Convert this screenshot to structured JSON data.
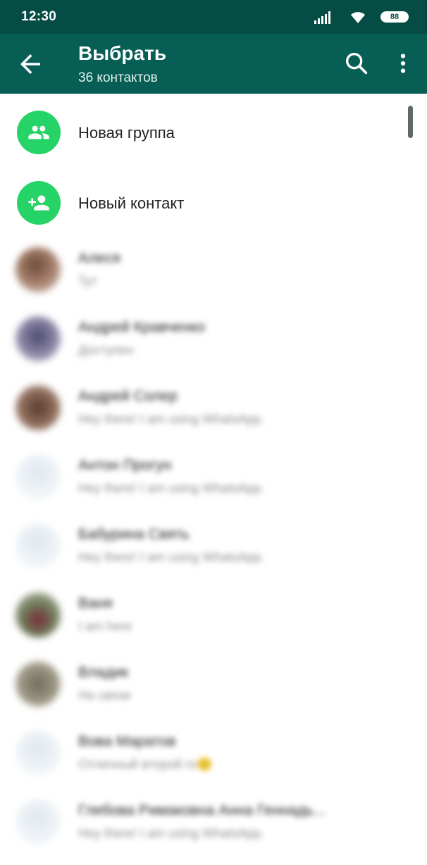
{
  "status": {
    "time": "12:30",
    "battery": "88"
  },
  "header": {
    "title": "Выбрать",
    "subtitle": "36 контактов"
  },
  "actions": [
    {
      "label": "Новая группа"
    },
    {
      "label": "Новый контакт"
    }
  ],
  "contacts": [
    {
      "name": "Алеся",
      "status": "Тут"
    },
    {
      "name": "Андрей Кравченко",
      "status": "Доступен"
    },
    {
      "name": "Андрей Солер",
      "status": "Hey there! I am using WhatsApp."
    },
    {
      "name": "Антон Прогун",
      "status": "Hey there! I am using WhatsApp."
    },
    {
      "name": "Бабурина Свять",
      "status": "Hey there! I am using WhatsApp."
    },
    {
      "name": "Ваня",
      "status": "I am here"
    },
    {
      "name": "Владик",
      "status": "На связи"
    },
    {
      "name": "Вова Маратов",
      "status": "Отличный второй го🙂"
    },
    {
      "name": "Глебова Римаковна Анна Геннадь...",
      "status": "Hey there! I am using WhatsApp."
    }
  ],
  "colors": {
    "status_bar": "#054d44",
    "app_bar": "#075e54",
    "accent": "#25d366"
  },
  "icons": [
    "signal-icon",
    "wifi-icon",
    "battery-icon",
    "back-arrow-icon",
    "search-icon",
    "more-vert-icon",
    "group-icon",
    "add-person-icon"
  ]
}
